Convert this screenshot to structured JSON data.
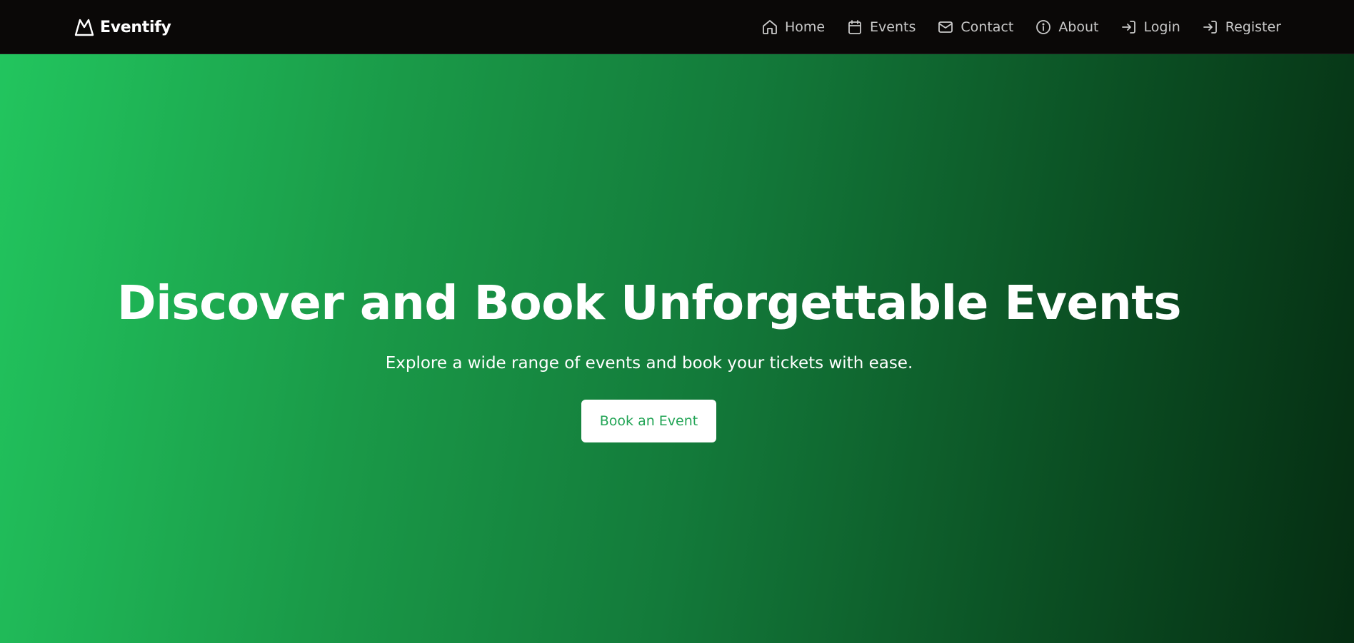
{
  "header": {
    "brand": {
      "name": "Eventify",
      "icon": "mountain-logo-icon"
    },
    "nav": [
      {
        "label": "Home",
        "icon": "home-icon"
      },
      {
        "label": "Events",
        "icon": "calendar-icon"
      },
      {
        "label": "Contact",
        "icon": "mail-icon"
      },
      {
        "label": "About",
        "icon": "info-icon"
      },
      {
        "label": "Login",
        "icon": "login-icon"
      },
      {
        "label": "Register",
        "icon": "login-icon"
      }
    ]
  },
  "hero": {
    "title": "Discover and Book Unforgettable Events",
    "subtitle": "Explore a wide range of events and book your tickets with ease.",
    "cta_label": "Book an Event"
  },
  "colors": {
    "navbar_bg": "#0a0807",
    "gradient_start": "#22c55e",
    "gradient_end": "#052d12",
    "button_text": "#22a455",
    "nav_text": "#c9c9c9"
  }
}
